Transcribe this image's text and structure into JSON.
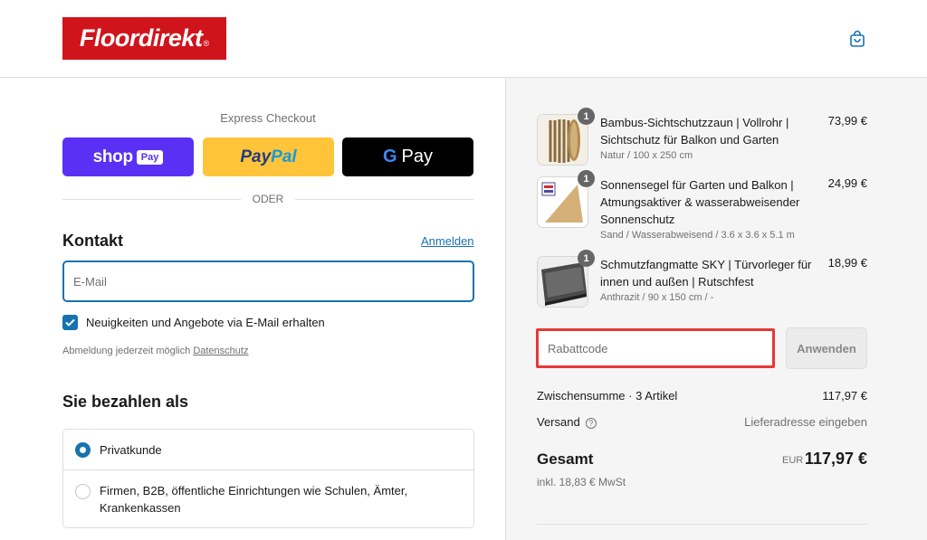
{
  "brand": {
    "logo_text": "Floordirekt",
    "logo_reg": "®",
    "color": "#d0141c"
  },
  "header": {
    "cart_icon": "shopping-bag-icon"
  },
  "express": {
    "label": "Express Checkout",
    "shop_pay": {
      "text": "shop",
      "badge": "Pay",
      "color": "#5a31f4"
    },
    "paypal": {
      "pay": "Pay",
      "pal": "Pal",
      "color": "#ffc439"
    },
    "gpay": {
      "g": "G",
      "text": "Pay",
      "color": "#000000"
    },
    "divider": "ODER"
  },
  "contact": {
    "title": "Kontakt",
    "login_link": "Anmelden",
    "email_placeholder": "E-Mail",
    "newsletter_label": "Neuigkeiten und Angebote via E-Mail erhalten",
    "newsletter_checked": true,
    "unsubscribe_note": "Abmeldung jederzeit möglich",
    "privacy_link": "Datenschutz"
  },
  "payer": {
    "title": "Sie bezahlen als",
    "options": [
      {
        "label": "Privatkunde",
        "selected": true
      },
      {
        "label": "Firmen, B2B, öffentliche Einrichtungen wie Schulen, Ämter, Krankenkassen",
        "selected": false
      }
    ]
  },
  "cart": {
    "items": [
      {
        "qty": "1",
        "title": "Bambus-Sichtschutzzaun | Vollrohr | Sichtschutz für Balkon und Garten",
        "variant": "Natur / 100 x 250 cm",
        "price": "73,99 €"
      },
      {
        "qty": "1",
        "title": "Sonnensegel für Garten und Balkon | Atmungsaktiver & wasserabweisender Sonnenschutz",
        "variant": "Sand / Wasserabweisend / 3.6 x 3.6 x 5.1 m",
        "price": "24,99 €"
      },
      {
        "qty": "1",
        "title": "Schmutzfangmatte SKY | Türvorleger für innen und außen | Rutschfest",
        "variant": "Anthrazit / 90 x 150 cm / -",
        "price": "18,99 €"
      }
    ],
    "discount_placeholder": "Rabattcode",
    "apply_label": "Anwenden",
    "subtotal_label": "Zwischensumme · 3 Artikel",
    "subtotal_value": "117,97 €",
    "shipping_label": "Versand",
    "shipping_value": "Lieferadresse eingeben",
    "total_label": "Gesamt",
    "total_currency": "EUR",
    "total_value": "117,97 €",
    "tax_note": "inkl. 18,83 € MwSt"
  },
  "colors": {
    "accent": "#1773b0",
    "highlight": "#e53935",
    "summary_bg": "#f5f5f5"
  }
}
